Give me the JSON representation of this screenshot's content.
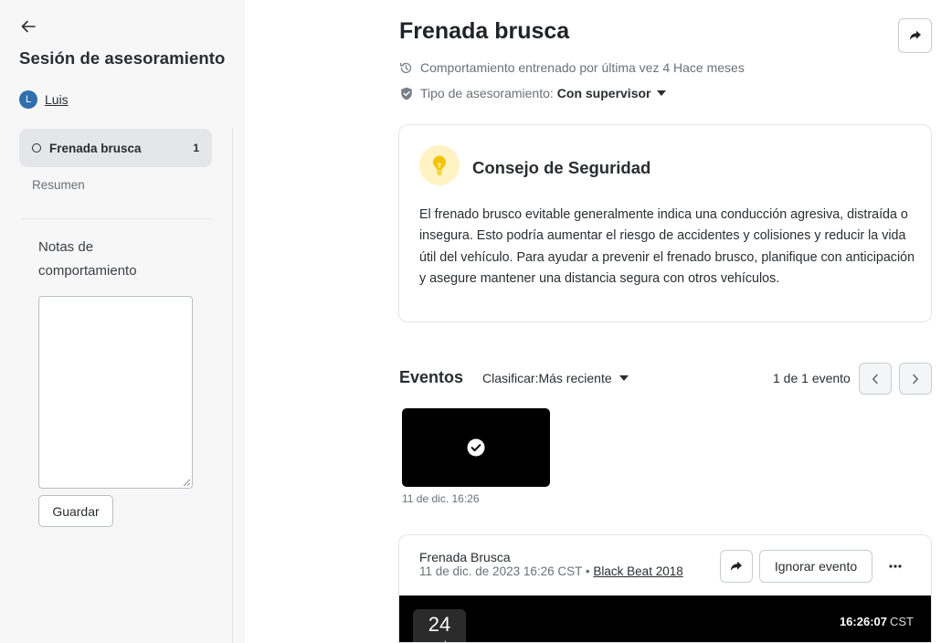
{
  "sidebar": {
    "title": "Sesión de asesoramiento",
    "driver": {
      "initial": "L",
      "name": "Luis"
    },
    "behaviors": [
      {
        "label": "Frenada brusca",
        "count": "1"
      }
    ],
    "summary_label": "Resumen",
    "notes_label": "Notas de comportamiento",
    "save_label": "Guardar"
  },
  "header": {
    "title": "Frenada brusca",
    "last_trained": "Comportamiento entrenado por última vez 4 Hace meses",
    "coach_type_label": "Tipo de asesoramiento:",
    "coach_type_value": "Con supervisor"
  },
  "tip": {
    "title": "Consejo de Seguridad",
    "body": "El frenado brusco evitable generalmente indica una conducción agresiva, distraída o insegura. Esto podría aumentar el riesgo de accidentes y colisiones y reducir la vida útil del vehículo. Para ayudar a prevenir el frenado brusco, planifique con anticipación y asegure mantener una distancia segura con otros vehículos."
  },
  "events": {
    "title": "Eventos",
    "sort_label": "Clasificar:",
    "sort_value": "Más reciente",
    "count_text": "1 de 1 evento",
    "thumbnail_date": "11 de dic. 16:26"
  },
  "event_detail": {
    "name": "Frenada Brusca",
    "datetime": "11 de dic. de 2023 16:26 CST",
    "separator": "•",
    "vehicle": "Black Beat 2018",
    "ignore_label": "Ignorar evento",
    "speed": "24",
    "speed_unit": "mph",
    "time": "16:26:07",
    "timezone": "CST"
  },
  "colors": {
    "sidebar_bg": "#f7f7f8",
    "avatar": "#2f6fad",
    "bulb_bg": "#fff3c4",
    "bulb": "#f2c500"
  },
  "icons": {
    "back": "arrow-left-icon",
    "history": "history-icon",
    "shield": "shield-check-icon",
    "bulb": "lightbulb-icon",
    "share": "share-arrow-icon",
    "check": "check-circle-icon",
    "more": "more-horizontal-icon"
  }
}
